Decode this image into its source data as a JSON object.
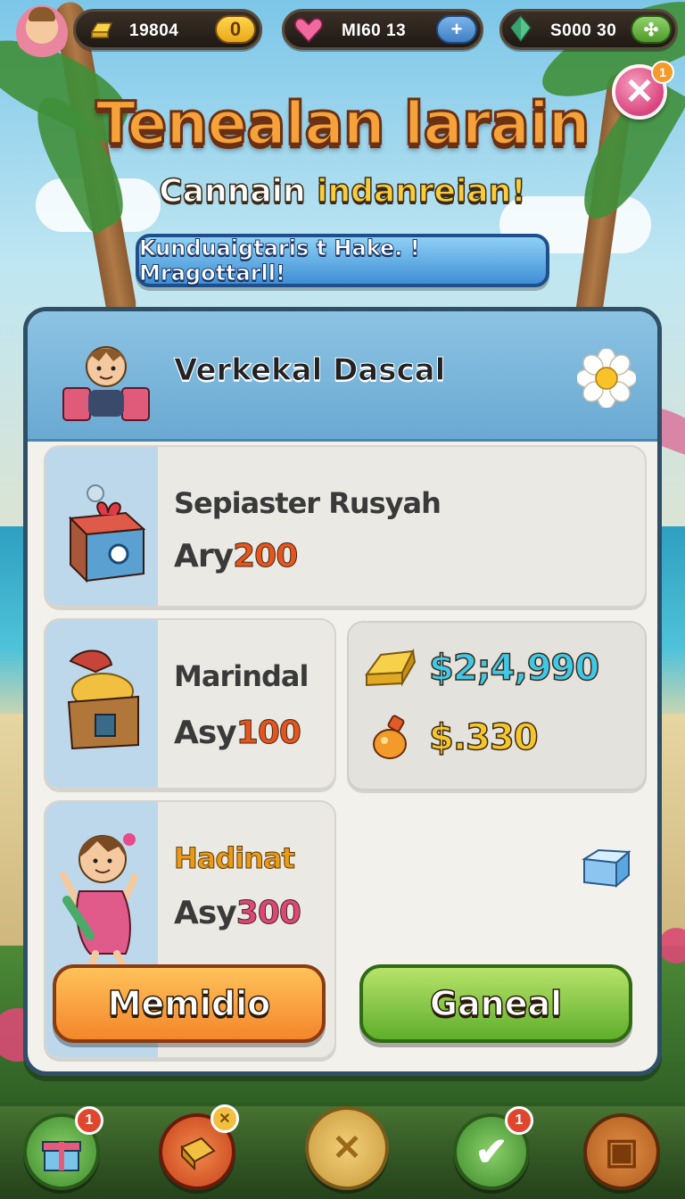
{
  "topbar": {
    "gold": {
      "value": "19804",
      "button": "0"
    },
    "hearts": {
      "value": "MI60  13",
      "button": "+"
    },
    "gems": {
      "value": "S000  30",
      "button": "✣"
    }
  },
  "close": {
    "label": "✕",
    "badge": "1"
  },
  "header": {
    "title": "Tenealan larain",
    "subtitle_a": "Cannain ",
    "subtitle_b": "indanreian!",
    "banner": "Kunduaigtaris t Hake. ! Mragottarll!"
  },
  "panel": {
    "title": "Verkekal Dascal",
    "items": [
      {
        "name": "Sepiaster Rusyah",
        "price_prefix": "Ary",
        "price": "200",
        "price_color": "#e8551c"
      },
      {
        "name": "Marindal",
        "price_prefix": "Asy",
        "price": "100",
        "price_color": "#e8551c"
      },
      {
        "name": "Hadinat",
        "price_prefix": "Asy",
        "price": "300",
        "price_color": "#e0457a",
        "name_color": "#e89a18"
      }
    ],
    "currency": [
      {
        "value": "$2;4,990",
        "color": "#3fc8e8"
      },
      {
        "value": "$.330",
        "color": "#f5c52a"
      }
    ],
    "buttons": {
      "left": "Memidio",
      "right": "Ganeal"
    }
  },
  "nav": {
    "badges": [
      "1",
      "",
      "",
      "1",
      ""
    ]
  }
}
